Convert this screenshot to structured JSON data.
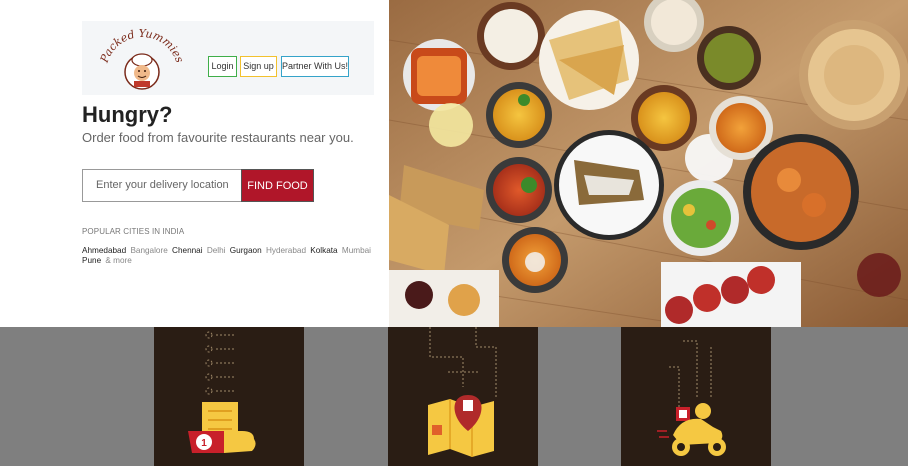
{
  "header": {
    "logo_text": "Packed Yummies",
    "login_label": "Login",
    "signup_label": "Sign up",
    "partner_label": "Partner With Us!"
  },
  "hero": {
    "headline": "Hungry?",
    "subline": "Order food from favourite restaurants near you."
  },
  "search": {
    "placeholder": "Enter your delivery location",
    "button_label": "FIND FOOD"
  },
  "popular": {
    "heading": "POPULAR CITIES IN INDIA",
    "cities": [
      {
        "name": "Ahmedabad",
        "dark": true
      },
      {
        "name": "Bangalore",
        "dark": false
      },
      {
        "name": "Chennai",
        "dark": true
      },
      {
        "name": "Delhi",
        "dark": false
      },
      {
        "name": "Gurgaon",
        "dark": true
      },
      {
        "name": "Hyderabad",
        "dark": false
      },
      {
        "name": "Kolkata",
        "dark": true
      },
      {
        "name": "Mumbai",
        "dark": false
      },
      {
        "name": "Pune",
        "dark": true
      },
      {
        "name": "& more",
        "dark": false
      }
    ]
  },
  "steps": [
    {
      "icon": "order-checklist-icon"
    },
    {
      "icon": "location-map-icon"
    },
    {
      "icon": "delivery-scooter-icon"
    }
  ],
  "colors": {
    "find_button": "#b01629",
    "login_border": "#3fae49",
    "signup_border": "#f2c12e",
    "partner_border": "#35a3c9",
    "panel_bg": "#2a1d14",
    "page_bg": "#7f7f7f"
  }
}
